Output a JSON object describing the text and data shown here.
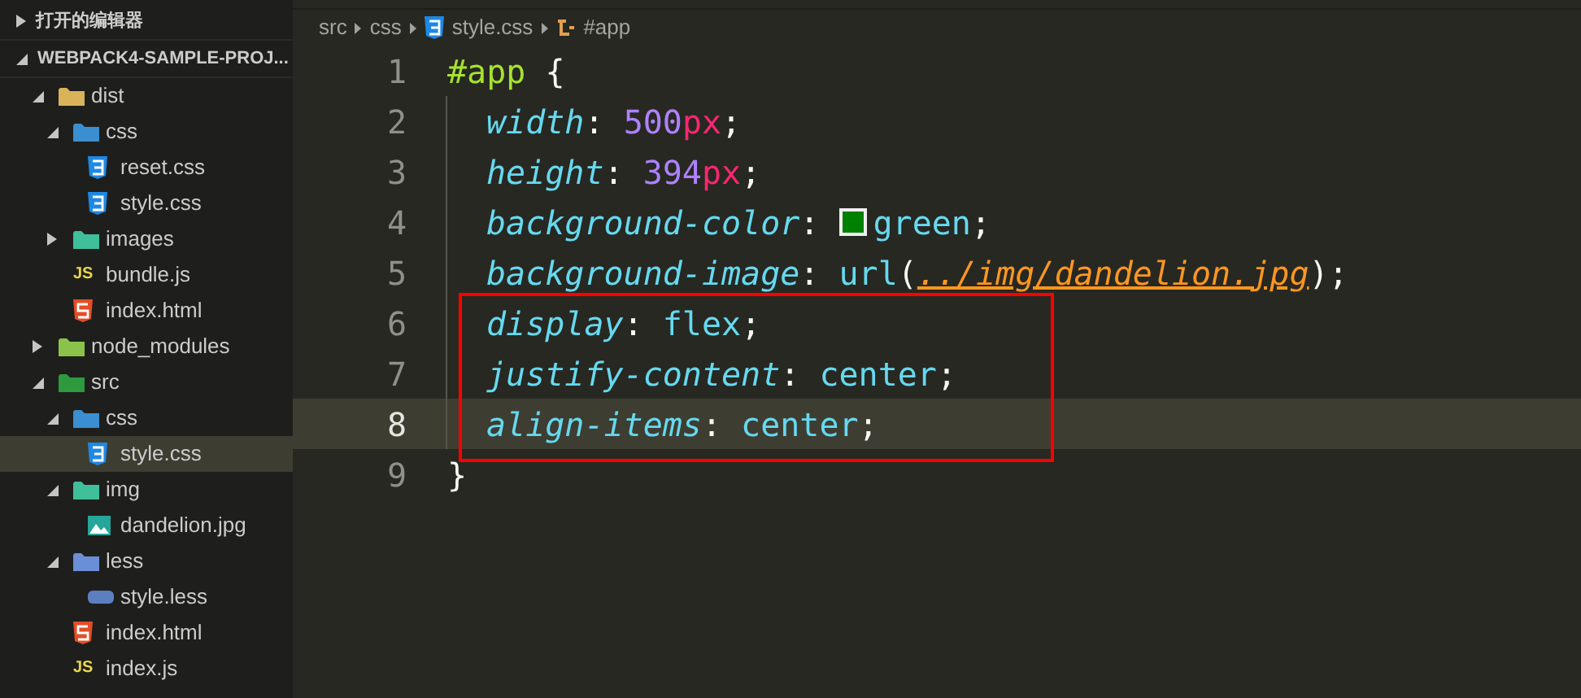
{
  "sidebar": {
    "sections": [
      {
        "title": "打开的编辑器",
        "expanded": false
      },
      {
        "title": "WEBPACK4-SAMPLE-PROJ...",
        "expanded": true
      }
    ],
    "tree": [
      {
        "label": "dist",
        "kind": "folder-dist",
        "expanded": true,
        "selected": false,
        "children": [
          {
            "label": "css",
            "kind": "folder-css",
            "expanded": true,
            "selected": false,
            "children": [
              {
                "label": "reset.css",
                "kind": "css",
                "selected": false
              },
              {
                "label": "style.css",
                "kind": "css",
                "selected": false
              }
            ]
          },
          {
            "label": "images",
            "kind": "folder-images",
            "expanded": false,
            "selected": false
          },
          {
            "label": "bundle.js",
            "kind": "js",
            "badge": "JS",
            "selected": false
          },
          {
            "label": "index.html",
            "kind": "html",
            "selected": false
          }
        ]
      },
      {
        "label": "node_modules",
        "kind": "folder-node",
        "expanded": false,
        "selected": false
      },
      {
        "label": "src",
        "kind": "folder-src",
        "expanded": true,
        "selected": false,
        "children": [
          {
            "label": "css",
            "kind": "folder-css",
            "expanded": true,
            "selected": false,
            "children": [
              {
                "label": "style.css",
                "kind": "css",
                "selected": true
              }
            ]
          },
          {
            "label": "img",
            "kind": "folder-images",
            "expanded": true,
            "selected": false,
            "children": [
              {
                "label": "dandelion.jpg",
                "kind": "image",
                "selected": false
              }
            ]
          },
          {
            "label": "less",
            "kind": "folder-less",
            "expanded": true,
            "selected": false,
            "children": [
              {
                "label": "style.less",
                "kind": "less",
                "selected": false
              }
            ]
          },
          {
            "label": "index.html",
            "kind": "html",
            "selected": false
          },
          {
            "label": "index.js",
            "kind": "js",
            "badge": "JS",
            "selected": false
          }
        ]
      }
    ]
  },
  "breadcrumb": [
    {
      "label": "src",
      "kind": "folder"
    },
    {
      "label": "css",
      "kind": "folder"
    },
    {
      "label": "style.css",
      "kind": "css"
    },
    {
      "label": "#app",
      "kind": "symbol"
    }
  ],
  "editor": {
    "lines": [
      {
        "number": "1",
        "current": false,
        "indented": false,
        "tokens": [
          {
            "text": "#app",
            "kind": "selector"
          },
          {
            "text": " {",
            "kind": "punct"
          }
        ]
      },
      {
        "number": "2",
        "current": false,
        "indented": true,
        "tokens": [
          {
            "text": "width",
            "kind": "property"
          },
          {
            "text": ": ",
            "kind": "punct"
          },
          {
            "text": "500",
            "kind": "number"
          },
          {
            "text": "px",
            "kind": "unit"
          },
          {
            "text": ";",
            "kind": "punct"
          }
        ]
      },
      {
        "number": "3",
        "current": false,
        "indented": true,
        "tokens": [
          {
            "text": "height",
            "kind": "property"
          },
          {
            "text": ": ",
            "kind": "punct"
          },
          {
            "text": "394",
            "kind": "number"
          },
          {
            "text": "px",
            "kind": "unit"
          },
          {
            "text": ";",
            "kind": "punct"
          }
        ]
      },
      {
        "number": "4",
        "current": false,
        "indented": true,
        "tokens": [
          {
            "text": "background-color",
            "kind": "property"
          },
          {
            "text": ": ",
            "kind": "punct"
          },
          {
            "kind": "swatch",
            "color": "#008000"
          },
          {
            "text": "green",
            "kind": "value"
          },
          {
            "text": ";",
            "kind": "punct"
          }
        ]
      },
      {
        "number": "5",
        "current": false,
        "indented": true,
        "tokens": [
          {
            "text": "background-image",
            "kind": "property"
          },
          {
            "text": ": ",
            "kind": "punct"
          },
          {
            "text": "url",
            "kind": "value"
          },
          {
            "text": "(",
            "kind": "punct"
          },
          {
            "text": "../img/dandelion.jpg",
            "kind": "string"
          },
          {
            "text": ");",
            "kind": "punct"
          }
        ]
      },
      {
        "number": "6",
        "current": false,
        "indented": true,
        "tokens": [
          {
            "text": "display",
            "kind": "property"
          },
          {
            "text": ": ",
            "kind": "punct"
          },
          {
            "text": "flex",
            "kind": "value"
          },
          {
            "text": ";",
            "kind": "punct"
          }
        ]
      },
      {
        "number": "7",
        "current": false,
        "indented": true,
        "tokens": [
          {
            "text": "justify-content",
            "kind": "property"
          },
          {
            "text": ": ",
            "kind": "punct"
          },
          {
            "text": "center",
            "kind": "value"
          },
          {
            "text": ";",
            "kind": "punct"
          }
        ]
      },
      {
        "number": "8",
        "current": true,
        "indented": true,
        "tokens": [
          {
            "text": "align-items",
            "kind": "property"
          },
          {
            "text": ": ",
            "kind": "punct"
          },
          {
            "text": "center",
            "kind": "value"
          },
          {
            "text": ";",
            "kind": "punct"
          }
        ]
      },
      {
        "number": "9",
        "current": false,
        "indented": false,
        "tokens": [
          {
            "text": "}",
            "kind": "punct"
          }
        ]
      }
    ]
  }
}
